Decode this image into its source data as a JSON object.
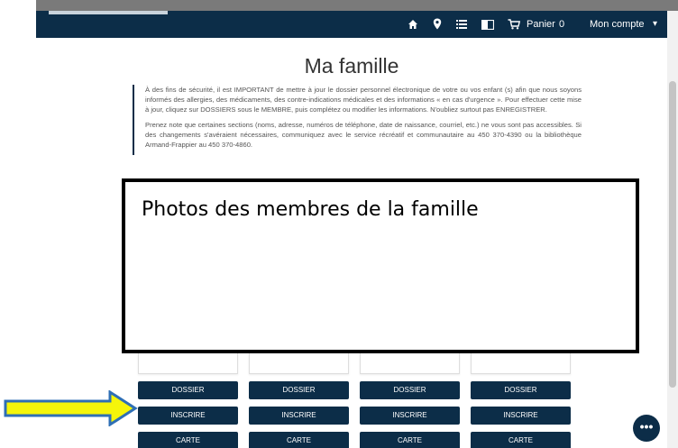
{
  "navbar": {
    "icons": [
      "home-icon",
      "location-icon",
      "list-icon",
      "book-icon",
      "cart-icon"
    ],
    "cart_label": "Panier",
    "cart_count": "0",
    "account_label": "Mon compte",
    "account_caret": "▾"
  },
  "page": {
    "title": "Ma famille",
    "info_paragraphs": [
      "À des fins de sécurité, il est IMPORTANT de mettre à jour le dossier personnel électronique de votre ou vos enfant (s) afin que nous soyons informés des allergies, des médicaments, des contre-indications médicales et des informations « en cas d'urgence ». Pour effectuer cette mise à jour, cliquez sur DOSSIERS sous le MEMBRE, puis complétez ou modifier les informations. N'oubliez surtout pas ENREGISTRER.",
      "Prenez note que certaines sections (noms, adresse, numéros de téléphone, date de naissance, courriel, etc.) ne vous sont pas accessibles. Si des changements s'avéraient nécessaires, communiquez avec le service récréatif et communautaire au 450 370-4390 ou la bibliothèque Armand-Frappier au 450 370-4860."
    ]
  },
  "overlay": {
    "label": "Photos des membres de la famille"
  },
  "members": [
    {
      "dossier": "DOSSIER",
      "inscrire": "INSCRIRE",
      "carte": "CARTE"
    },
    {
      "dossier": "DOSSIER",
      "inscrire": "INSCRIRE",
      "carte": "CARTE"
    },
    {
      "dossier": "DOSSIER",
      "inscrire": "INSCRIRE",
      "carte": "CARTE"
    },
    {
      "dossier": "DOSSIER",
      "inscrire": "INSCRIRE",
      "carte": "CARTE"
    }
  ],
  "fab": {
    "label": "•••"
  },
  "colors": {
    "navy": "#0c2d48",
    "arrow_fill": "#f5f50a",
    "arrow_stroke": "#2f6fb5"
  }
}
